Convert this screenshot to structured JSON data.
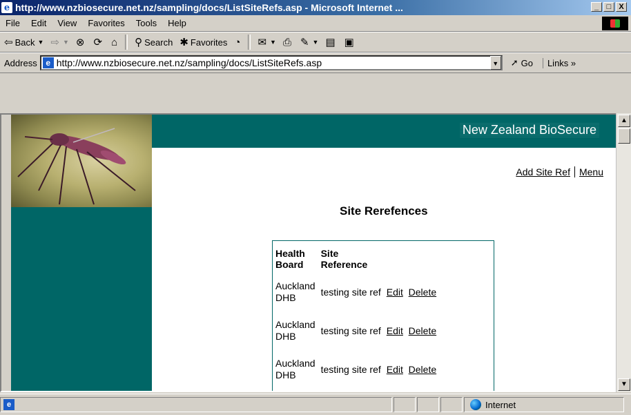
{
  "window": {
    "title": "http://www.nzbiosecure.net.nz/sampling/docs/ListSiteRefs.asp - Microsoft Internet ...",
    "min": "_",
    "max": "□",
    "close": "X"
  },
  "menu": [
    "File",
    "Edit",
    "View",
    "Favorites",
    "Tools",
    "Help"
  ],
  "toolbar": {
    "back": "Back",
    "search": "Search",
    "favorites": "Favorites"
  },
  "address": {
    "label": "Address",
    "url": "http://www.nzbiosecure.net.nz/sampling/docs/ListSiteRefs.asp",
    "go": "Go",
    "links": "Links"
  },
  "page": {
    "brand": "New Zealand BioSecure",
    "add_site_ref": "Add Site Ref",
    "menu_link": "Menu",
    "heading": "Site Rerefences",
    "table": {
      "col_health_board_1": "Health",
      "col_health_board_2": "Board",
      "col_site_ref_1": "Site",
      "col_site_ref_2": "Reference",
      "rows": [
        {
          "hb1": "Auckland",
          "hb2": "DHB",
          "site": "testing site ref",
          "edit": "Edit",
          "delete": "Delete"
        },
        {
          "hb1": "Auckland",
          "hb2": "DHB",
          "site": "testing site ref",
          "edit": "Edit",
          "delete": "Delete"
        },
        {
          "hb1": "Auckland",
          "hb2": "DHB",
          "site": "testing site ref",
          "edit": "Edit",
          "delete": "Delete"
        }
      ]
    }
  },
  "status": {
    "zone": "Internet"
  }
}
